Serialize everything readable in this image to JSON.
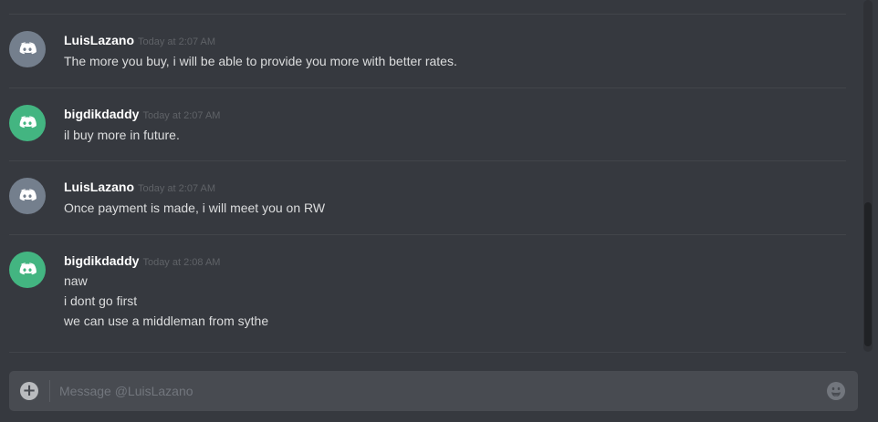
{
  "colors": {
    "background": "#36393f",
    "avatar_grey": "#747f8d",
    "avatar_green": "#43b581",
    "username": "#ffffff",
    "timestamp": "#5f6267",
    "message_text": "#dcddde"
  },
  "messages": [
    {
      "author": "LuisLazano",
      "timestamp": "Today at 2:07 AM",
      "avatar_icon": "discord-logo-icon",
      "avatar_color": "grey",
      "lines": [
        "The more you buy, i will be able to provide you more with better rates."
      ]
    },
    {
      "author": "bigdikdaddy",
      "timestamp": "Today at 2:07 AM",
      "avatar_icon": "discord-logo-icon",
      "avatar_color": "green",
      "lines": [
        "il buy more in future."
      ]
    },
    {
      "author": "LuisLazano",
      "timestamp": "Today at 2:07 AM",
      "avatar_icon": "discord-logo-icon",
      "avatar_color": "grey",
      "lines": [
        "Once payment is made, i will meet you on RW"
      ]
    },
    {
      "author": "bigdikdaddy",
      "timestamp": "Today at 2:08 AM",
      "avatar_icon": "discord-logo-icon",
      "avatar_color": "green",
      "lines": [
        "naw",
        "i dont go first",
        "we can use a middleman from sythe"
      ]
    }
  ],
  "input": {
    "placeholder": "Message @LuisLazano",
    "value": "",
    "attach_icon": "plus-circle-icon",
    "emoji_icon": "emoji-face-icon"
  }
}
